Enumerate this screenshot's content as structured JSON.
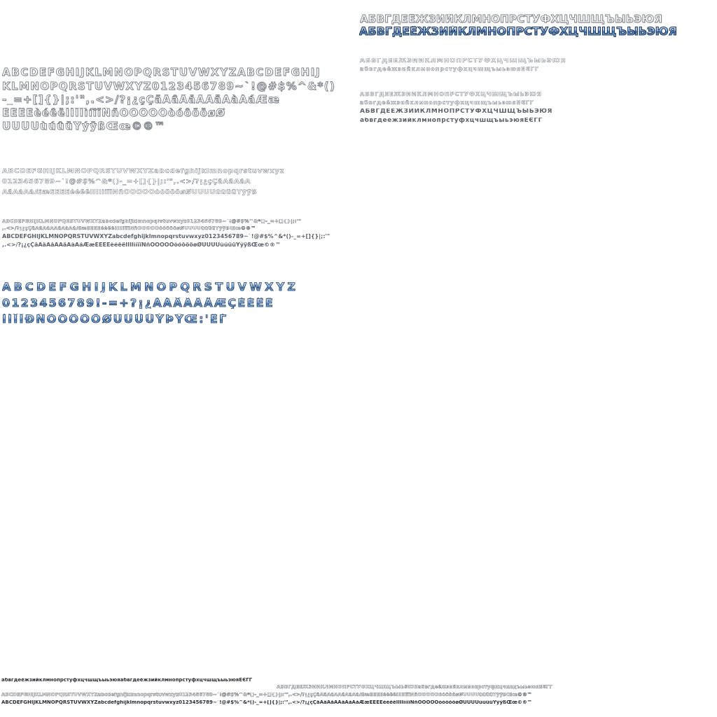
{
  "atlas": {
    "cyr_top_outline": "АБВГДЕЁЖЗИЙКЛМНОПРСТУФХЦЧШЩЪЫЬЭЮЯ",
    "cyr_top_chrome": "АБВГДЕЁЖЗИЙКЛМНОПРСТУФХЦЧШЩЪЫЬЭЮЯ",
    "cyr_small_1": "АБВГДЕЁЖЗИЙКЛМНОПРСТУФХЦЧШЩЪЫЬЭЮЯ",
    "cyr_small_2": "абвгдеёжзийклмнопрстуфхцчшщъыьэюяЁЄЃҐ",
    "cyr_small_3": "АБВГДЕЁЖЗИЙКЛМНОПРСТУФХЦЧШЩЪЫЬЭЮЯ",
    "cyr_small_4": "абвгдеёжзийклмнопрстуфхцчшщъыьэюяЁЄЃҐ",
    "cyr_small_5": "АБВГДЕЁЖЗИЙКЛМНОПРСТУФХЦЧШЩЪЫЬЭЮЯ",
    "cyr_small_6": "абвгдеёжзийклмнопрстуфхцчшщъыьэюяЁЄЃҐ",
    "lat_big_1": "ABCDEFGHIJKLMNOPQRSTUVWXYZABCDEFGHIJ",
    "lat_big_2": "KLMNOPQRSTUVWXYZ0123456789~`!@#$%^&*()",
    "lat_big_3": "-_=+[]{}|;:'\",.<>/?¡¿çÇãÃâÂåÅÄäÀàÁáÆæ",
    "lat_big_4": "ÈÉÊËèéêëÌÍÎÏìíîïÑñÒÓÔÕÖòóôõöøØ",
    "lat_big_5": "ÙÚÛÜùúûüÝýÿßŒœ©®™",
    "lat_med_1": "ABCDEFGHIJKLMNOPQRSTUVWXYZabcdefghijklmnopqrstuvwxyz",
    "lat_med_2": "0123456789~`!@#$%^&*()-_=+[]{}|;:'\",.<>/?¡¿çÇãÃâÂåÅ",
    "lat_med_3": "ÄäÀàÁáÆæÈÉÊËèéêëÌÍÎÏìíîïÑñÒÓÔÕÖòóôõöøØÙÚÛÜùúûüÝýÿß",
    "lat_small_1": "ABCDEFGHIJKLMNOPQRSTUVWXYZabcdefghijklmnopqrstuvwxyz0123456789~`!@#$%^&*()-_=+[]{}|;:'\"",
    "lat_small_2": ",.<>/?¡¿çÇãÃâÂåÅÄäÀàÁáÆæÈÉÊËèéêëÌÍÎÏìíîïÑñÒÓÔÕÖòóôõöøØÙÚÛÜùúûüÝýÿßŒœ©®™",
    "lat_small_3": "ABCDEFGHIJKLMNOPQRSTUVWXYZabcdefghijklmnopqrstuvwxyz0123456789~`!@#$%^&*()-_=+[]{}|;:'\"",
    "lat_small_4": ",.<>/?¡¿çÇãÃâÂåÅÄäÀàÁáÆæÈÉÊËèéêëÌÍÎÏìíîïÑñÒÓÔÕÖòóôõöøØÙÚÛÜùúûüÝýÿßŒœ©®™",
    "chrome_1": "ABCDEFGHIJKLMNOPQRSTUVWXYZ",
    "chrome_2": "0123456789!-=+?¡¿ÀÁÂÃÄÅÆÇÈÉÊË",
    "chrome_3": "ÌÍÎÏÐÑÒÓÔÕÖØÙÚÛÜÝÞŸŒ:'ЁЃ",
    "bottom_1": "абвгдеёжзийклмнопрстуфхцчшщъыьэюяабвгдеёжзийклмнопрстуфхцчшщъыьэюяЁЄЃҐ",
    "bottom_2": "АБВГДЕЁЖЗИЙКЛМНОПРСТУФХЦЧШЩЪЫЬЭЮЯабвгдеёжзийклмнопрстуфхцчшщъыьэюяЁЄЃҐ",
    "bottom_3": "ABCDEFGHIJKLMNOPQRSTUVWXYZabcdefghijklmnopqrstuvwxyz0123456789~`!@#$%^&*()-_=+[]{}|;:'\",.<>/?¡¿çÇãÃâÂåÅÄäÀàÁáÆæÈÉÊËèéêëÌÍÎÏìíîïÑñÒÓÔÕÖòóôõöøØÙÚÛÜùúûüÝýÿßŒœ©®™",
    "bottom_4": "ABCDEFGHIJKLMNOPQRSTUVWXYZabcdefghijklmnopqrstuvwxyz0123456789~`!@#$%^&*()-_=+[]{}|;:'\",.<>/?¡¿çÇãÃâÂåÅÄäÀàÁáÆæÈÉÊËèéêëÌÍÎÏìíîïÑñÒÓÔÕÖòóôõöøØÙÚÛÜùúûüÝýÿßŒœ©®™"
  }
}
